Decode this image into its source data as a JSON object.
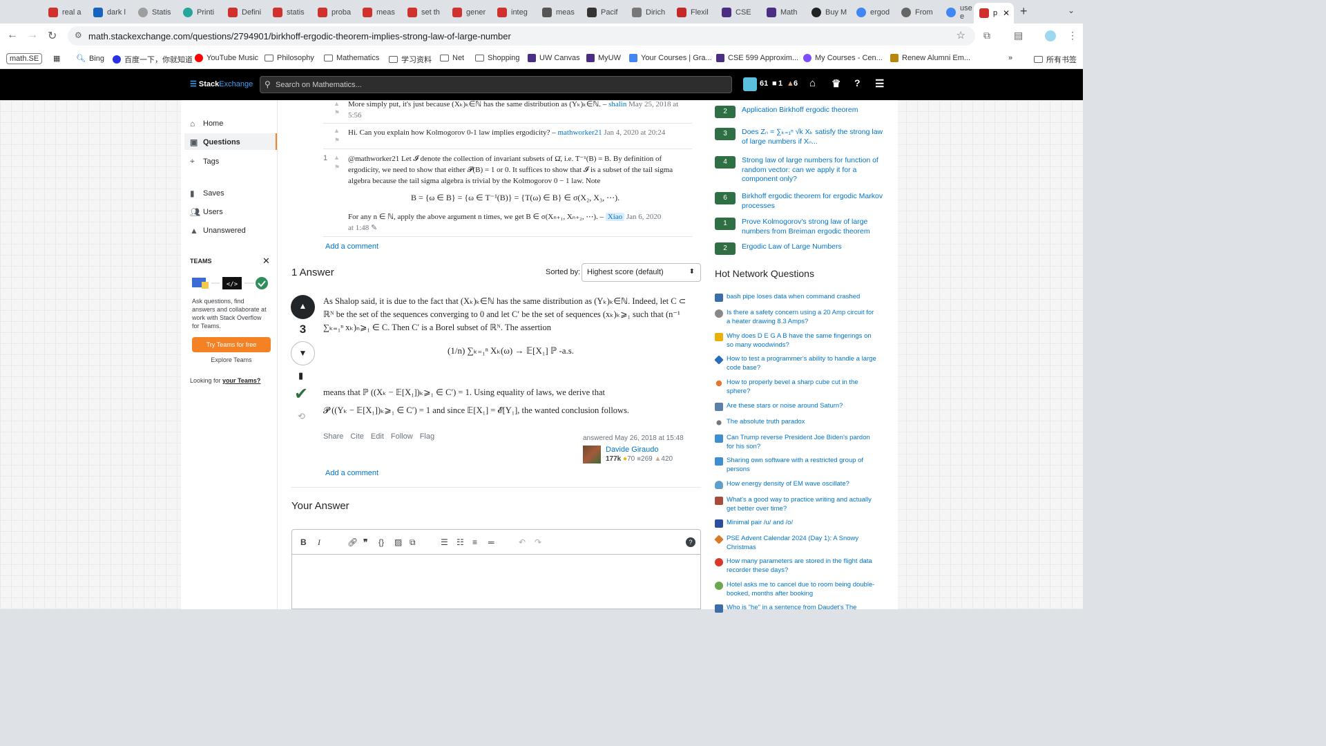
{
  "browser": {
    "tabs": [
      {
        "label": "real a",
        "color": "#d0312d"
      },
      {
        "label": "dark l",
        "color": "#1565c0"
      },
      {
        "label": "Statis",
        "color": "#9e9e9e"
      },
      {
        "label": "Printi",
        "color": "#26a69a"
      },
      {
        "label": "Defini",
        "color": "#d0312d"
      },
      {
        "label": "statis",
        "color": "#d0312d"
      },
      {
        "label": "proba",
        "color": "#d0312d"
      },
      {
        "label": "meas",
        "color": "#d0312d"
      },
      {
        "label": "set th",
        "color": "#d0312d"
      },
      {
        "label": "gener",
        "color": "#d0312d"
      },
      {
        "label": "integ",
        "color": "#d0312d"
      },
      {
        "label": "meas",
        "color": "#555555"
      },
      {
        "label": "Pacif",
        "color": "#333333"
      },
      {
        "label": "Dirich",
        "color": "#777777"
      },
      {
        "label": "Flexil",
        "color": "#c62828"
      },
      {
        "label": "CSE",
        "color": "#4b2e83"
      },
      {
        "label": "Math",
        "color": "#4b2e83"
      },
      {
        "label": "Buy M",
        "color": "#222222"
      },
      {
        "label": "ergod",
        "color": "#4285f4"
      },
      {
        "label": "From",
        "color": "#666666"
      },
      {
        "label": "use e",
        "color": "#4285f4"
      },
      {
        "label": "p",
        "color": "#d0312d"
      }
    ],
    "url": "math.stackexchange.com/questions/2794901/birkhoff-ergodic-theorem-implies-strong-law-of-large-number",
    "bookmarks": [
      "Bing",
      "百度一下，你就知道",
      "YouTube Music",
      "Philosophy",
      "Mathematics",
      "学习资料",
      "Net",
      "Shopping",
      "UW Canvas",
      "MyUW",
      "Your Courses | Gra...",
      "CSE 599 Approxim...",
      "My Courses - Cen...",
      "Renew Alumni Em..."
    ],
    "bookmark_chip": "math.SE",
    "all_bookmarks": "所有书签"
  },
  "topbar": {
    "logo_a": "Stack",
    "logo_b": "Exchange",
    "search_placeholder": "Search on Mathematics...",
    "rep": "61",
    "silver": "1",
    "bronze": "6"
  },
  "leftnav": {
    "home": "Home",
    "questions": "Questions",
    "tags": "Tags",
    "saves": "Saves",
    "users": "Users",
    "unanswered": "Unanswered",
    "teams_heading": "TEAMS",
    "teams_text": "Ask questions, find answers and collaborate at work with Stack Overflow for Teams.",
    "teams_button": "Try Teams for free",
    "explore": "Explore Teams",
    "looking_for": "Looking for ",
    "your_teams": "your Teams?"
  },
  "comments": {
    "c1_text": "More simply put, it's just because (Xₖ)ₖ∈ℕ has the same distribution as (Yₖ)ₖ∈ℕ. –",
    "c1_user": "shalin",
    "c1_date": "May 25, 2018 at 5:56",
    "c2_text": "Hi. Can you explain how Kolmogorov 0-1 law implies ergodicity? –",
    "c2_user": "mathworker21",
    "c2_date": "Jan 4, 2020 at 20:24",
    "c3_score": "1",
    "c3_text": "@mathworker21 Let 𝓘 denote the collection of invariant subsets of Ω̄, i.e. T⁻¹(B) = B. By definition of ergodicity, we need to show that either 𝓟(B) = 1 or 0. It suffices to show that 𝓘 is a subset of the tail sigma algebra because the tail sigma algebra is trivial by the Kolmogorov 0 − 1 law. Note",
    "c3_formula": "B = {ω ∈ B} = {ω ∈ T⁻¹(B)} = {T(ω) ∈ B} ∈ σ(X₂, X₃, ⋯).",
    "c3_text2": "For any n ∈ ℕ, apply the above argument n times, we get B ∈ σ(Xₙ₊₁, Xₙ₊₂, ⋯). –",
    "c3_user": "Xiao",
    "c3_date": "Jan 6, 2020",
    "c3_date2": "at 1:48",
    "add_comment": "Add a comment"
  },
  "answers": {
    "heading": "1 Answer",
    "sorted_by": "Sorted by:",
    "sort_value": "Highest score (default)"
  },
  "answer": {
    "score": "3",
    "p1": "As Shalop said, it is due to the fact that (Xₖ)ₖ∈ℕ has the same distribution as (Yₖ)ₖ∈ℕ. Indeed, let C ⊂ ℝᴺ be the set of the sequences converging to 0 and let C′ be the set of sequences (xₖ)ₖ⩾₁ such that (n⁻¹ ∑ₖ₌₁ⁿ xₖ)ₙ⩾₁ ∈ C. Then C′ is a Borel subset of ℝᴺ. The assertion",
    "formula": "(1/n) ∑ₖ₌₁ⁿ Xₖ(ω) → 𝔼[X₁]   ℙ -a.s.",
    "p2": "means that ℙ ((Xₖ − 𝔼[X₁])ₖ⩾₁ ∈ C′) = 1. Using equality of laws, we derive that",
    "p3": "𝓟 ((Yₖ − 𝔼[X₁])ₖ⩾₁ ∈ C′) = 1 and since 𝔼[X₁] = 𝓔[Y₁], the wanted conclusion follows.",
    "share": "Share",
    "cite": "Cite",
    "edit": "Edit",
    "follow": "Follow",
    "flag": "Flag",
    "answered": "answered May 26, 2018 at 15:48",
    "user": "Davide Giraudo",
    "rep": "177k",
    "gold": "70",
    "silver": "269",
    "bronze": "420",
    "add_comment": "Add a comment"
  },
  "your_answer": {
    "heading": "Your Answer"
  },
  "related": [
    {
      "score": "2",
      "title": "Application Birkhoff ergodic theorem"
    },
    {
      "score": "3",
      "title": "Does Zₙ = ∑ₖ₌₁ⁿ √k Xₖ satisfy the strong law of large numbers if Xₙ..."
    },
    {
      "score": "4",
      "title": "Strong law of large numbers for function of random vector: can we apply it for a component only?"
    },
    {
      "score": "6",
      "title": "Birkhoff ergodic theorem for ergodic Markov processes"
    },
    {
      "score": "1",
      "title": "Prove Kolmogorov's strong law of large numbers from Breiman ergodic theorem"
    },
    {
      "score": "2",
      "title": "Ergodic Law of Large Numbers"
    }
  ],
  "hot": {
    "heading": "Hot Network Questions",
    "items": [
      {
        "title": "bash pipe loses data when command crashed",
        "color": "#3b6ea8"
      },
      {
        "title": "Is there a safety concern using a 20 Amp circuit for a heater drawing 8.3 Amps?",
        "color": "#888888"
      },
      {
        "title": "Why does D E G A B have the same fingerings on so many woodwinds?",
        "color": "#e8b20a"
      },
      {
        "title": "How to test a programmer's ability to handle a large code base?",
        "color": "#2a6ebb"
      },
      {
        "title": "How to properly bevel a sharp cube cut in the sphere?",
        "color": "#e8772e"
      },
      {
        "title": "Are these stars or noise around Saturn?",
        "color": "#5a7fa8"
      },
      {
        "title": "The absolute truth paradox",
        "color": "#777777"
      },
      {
        "title": "Can Trump reverse President Joe Biden's pardon for his son?",
        "color": "#3d8fd1"
      },
      {
        "title": "Sharing own software with a restricted group of persons",
        "color": "#3d8fd1"
      },
      {
        "title": "How energy density of EM wave oscillate?",
        "color": "#5fa0c8"
      },
      {
        "title": "What's a good way to practice writing and actually get better over time?",
        "color": "#a84b3a"
      },
      {
        "title": "Minimal pair /u/ and /o/",
        "color": "#2a4f9e"
      },
      {
        "title": "PSE Advent Calendar 2024 (Day 1): A Snowy Christmas",
        "color": "#d97a2b"
      },
      {
        "title": "How many parameters are stored in the flight data recorder these days?",
        "color": "#d9382b"
      },
      {
        "title": "Hotel asks me to cancel due to room being double-booked, months after booking",
        "color": "#6aa84f"
      },
      {
        "title": "Who is \"he\" in a sentence from Daudet's The",
        "color": "#3b6ea8"
      }
    ]
  }
}
